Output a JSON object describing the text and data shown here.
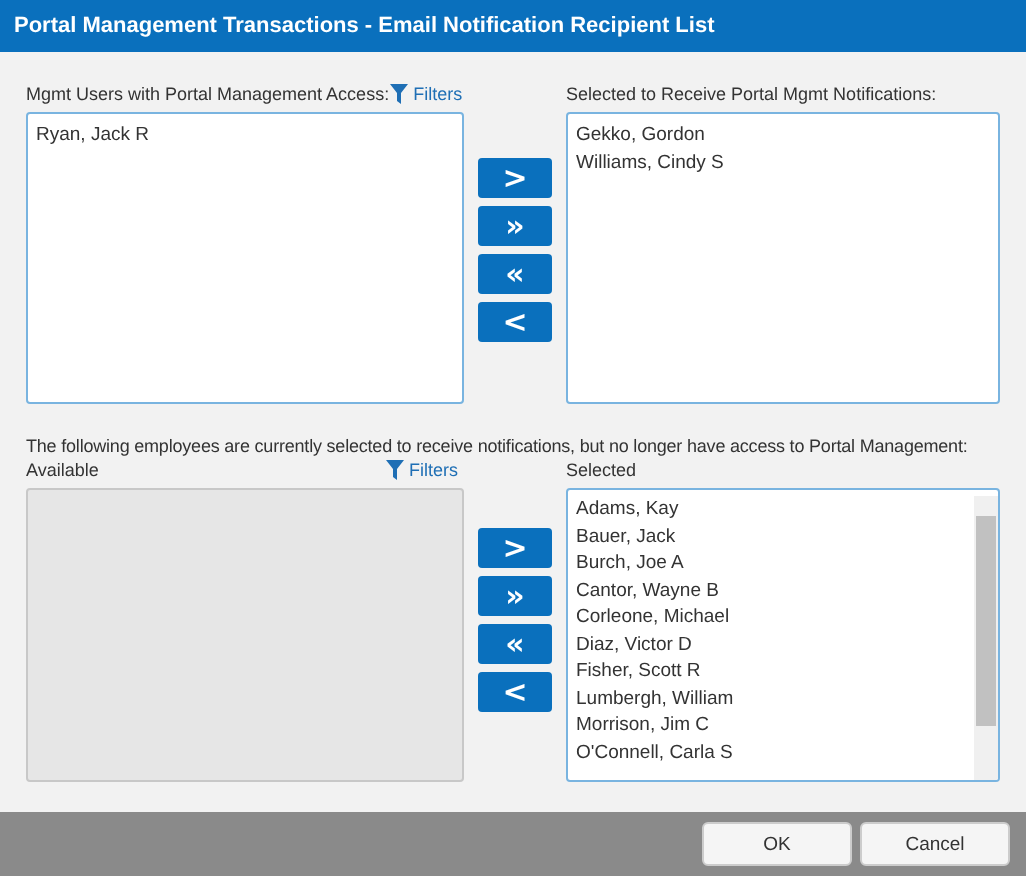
{
  "window": {
    "title": "Portal Management Transactions - Email Notification Recipient List"
  },
  "top": {
    "available": {
      "label": "Mgmt Users with Portal Management Access:",
      "filters": "Filters",
      "disabled": false,
      "items": [
        "Ryan, Jack R"
      ]
    },
    "selected": {
      "label": "Selected to Receive Portal Mgmt Notifications:",
      "items": [
        "Gekko, Gordon",
        "Williams, Cindy S"
      ]
    },
    "buttons": [
      ">",
      "»",
      "«",
      "<"
    ]
  },
  "bottom": {
    "note": "The following employees are currently selected to receive notifications, but no longer have access to Portal Management:",
    "available": {
      "label": "Available",
      "filters": "Filters",
      "disabled": true
    },
    "selected": {
      "label": "Selected",
      "items": [
        "Adams, Kay",
        "Bauer, Jack",
        "Burch, Joe A",
        "Cantor, Wayne B",
        "Corleone, Michael",
        "Diaz, Victor D",
        "Fisher, Scott R",
        "Lumbergh, William",
        "Morrison, Jim C",
        "O'Connell, Carla S"
      ]
    },
    "buttons": [
      ">",
      "»",
      "«",
      "<"
    ]
  },
  "footer": {
    "buttons": [
      "OK",
      "Cancel"
    ]
  }
}
